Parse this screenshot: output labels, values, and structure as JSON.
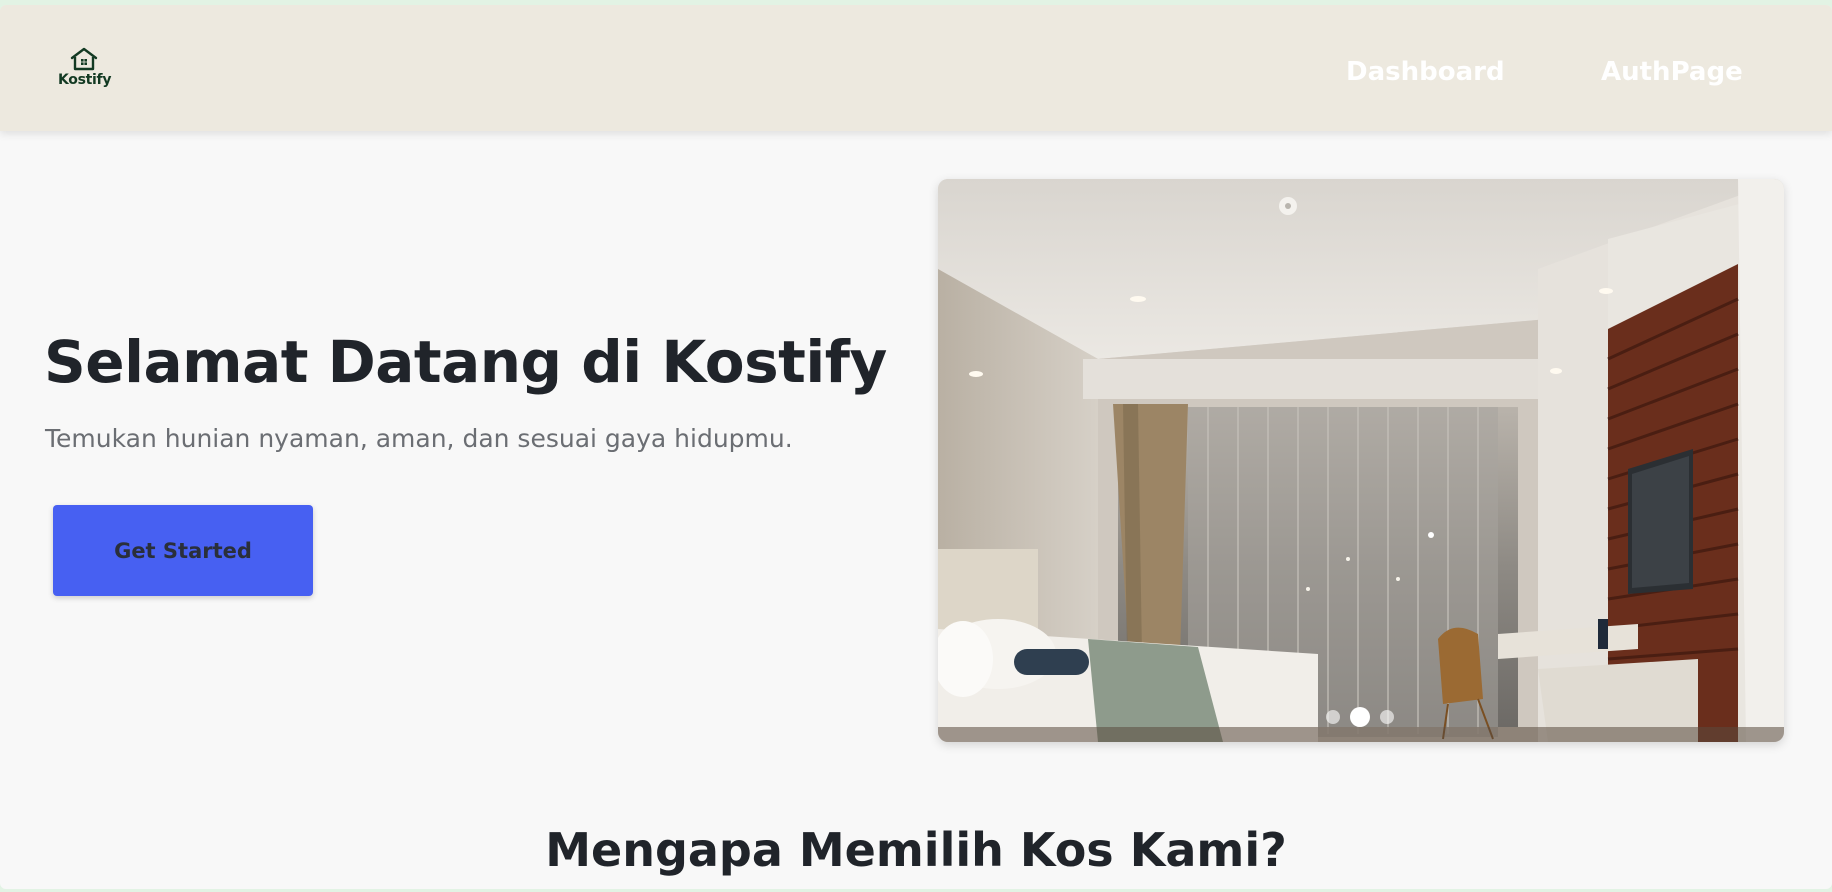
{
  "navbar": {
    "logo_text": "Kostify",
    "links": [
      {
        "label": "Dashboard"
      },
      {
        "label": "AuthPage"
      }
    ]
  },
  "hero": {
    "title": "Selamat Datang di Kostify",
    "subtitle": "Temukan hunian nyaman, aman, dan sesuai gaya hidupmu.",
    "cta_label": "Get Started"
  },
  "carousel": {
    "slide_count": 3,
    "active_index": 1
  },
  "section": {
    "title": "Mengapa Memilih Kos Kami?"
  },
  "colors": {
    "navbar_bg": "#ede9df",
    "brand_dark": "#133a23",
    "cta_blue": "#4760f2",
    "page_bg": "#f8f8f8"
  }
}
